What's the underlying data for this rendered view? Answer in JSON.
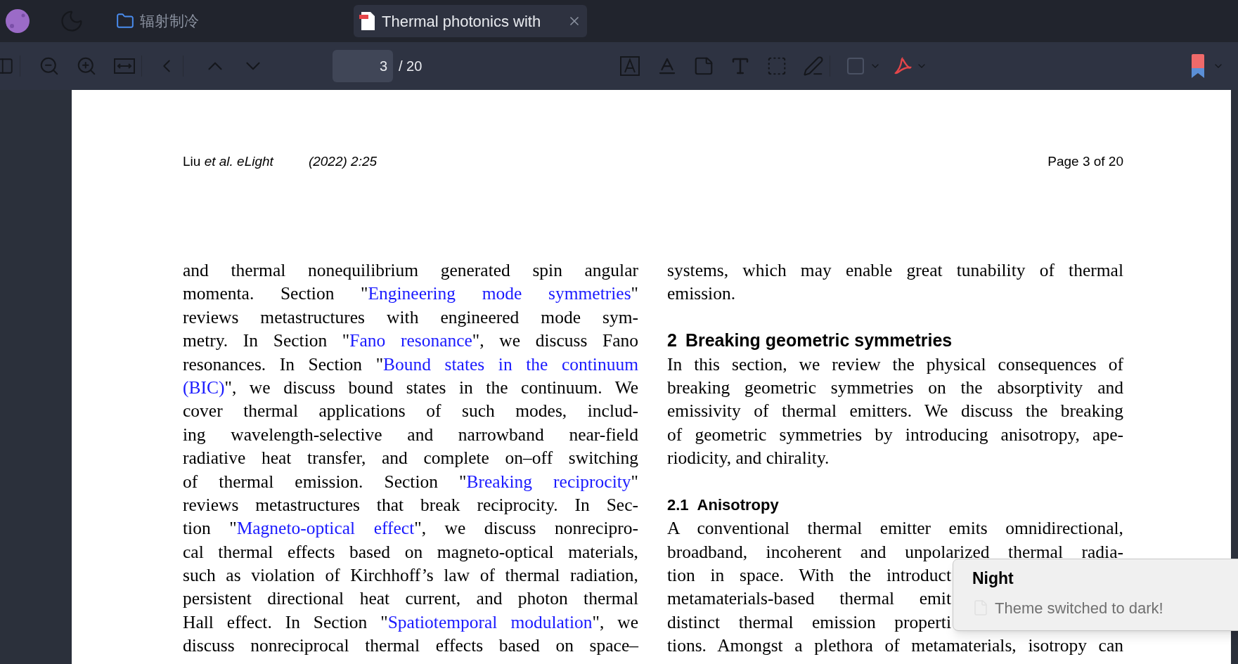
{
  "title_bar": {
    "folder": "辐射制冷",
    "tab": {
      "title": "Thermal photonics with",
      "selected": true
    }
  },
  "toolbar": {
    "page_input": "3",
    "page_total": "/ 20"
  },
  "page": {
    "header": {
      "citation": "Liu *et al. eLight*",
      "volume": "(2022) 2:25",
      "page_label": "Page 3 of 20"
    },
    "left_column": [
      [
        {
          "text": "and thermal nonequilibrium generated spin angular"
        }
      ],
      [
        {
          "text": "momenta. Section \""
        },
        {
          "text": "Engineering mode symmetries",
          "link": true
        },
        {
          "text": "\""
        }
      ],
      [
        {
          "text": "reviews metastructures with engineered mode sym-"
        }
      ],
      [
        {
          "text": "metry. In Section \""
        },
        {
          "text": "Fano resonance",
          "link": true
        },
        {
          "text": "\", we discuss Fano"
        }
      ],
      [
        {
          "text": "resonances. In Section \""
        },
        {
          "text": "Bound states in the continuum",
          "link": true
        }
      ],
      [
        {
          "text": "(BIC)",
          "link": true
        },
        {
          "text": "\", we discuss bound states in the continuum. We"
        }
      ],
      [
        {
          "text": "cover thermal applications of such modes, includ-"
        }
      ],
      [
        {
          "text": "ing wavelength-selective and narrowband near-field"
        }
      ],
      [
        {
          "text": "radiative heat transfer, and complete on–off switching"
        }
      ],
      [
        {
          "text": "of thermal emission. Section \""
        },
        {
          "text": "Breaking reciprocity",
          "link": true
        },
        {
          "text": "\""
        }
      ],
      [
        {
          "text": "reviews metastructures that break reciprocity. In Sec-"
        }
      ],
      [
        {
          "text": "tion \""
        },
        {
          "text": "Magneto-optical effect",
          "link": true
        },
        {
          "text": "\", we discuss nonrecipro-"
        }
      ],
      [
        {
          "text": "cal thermal effects based on magneto-optical materials,"
        }
      ],
      [
        {
          "text": "such as violation of Kirchhoff’s law of thermal radiation,"
        }
      ],
      [
        {
          "text": "persistent directional heat current, and photon thermal"
        }
      ],
      [
        {
          "text": "Hall effect. In Section \""
        },
        {
          "text": "Spatiotemporal modulation",
          "link": true
        },
        {
          "text": "\", we"
        }
      ],
      [
        {
          "text": "discuss nonreciprocal thermal effects based on space–"
        }
      ]
    ],
    "right_column": [
      {
        "kind": "line",
        "text": "systems, which may enable great tunability of thermal"
      },
      {
        "kind": "last",
        "text": "emission."
      },
      {
        "kind": "heading",
        "number": "2",
        "text": "Breaking geometric symmetries"
      },
      {
        "kind": "line",
        "text": "In this section, we review the physical consequences of"
      },
      {
        "kind": "line",
        "text": "breaking geometric symmetries on the absorptivity and"
      },
      {
        "kind": "line",
        "text": "emissivity of thermal emitters. We discuss the breaking"
      },
      {
        "kind": "line",
        "text": "of geometric symmetries by introducing anisotropy, ape-"
      },
      {
        "kind": "last",
        "text": "riodicity, and chirality."
      },
      {
        "kind": "subheading",
        "number": "2.1",
        "text": "Anisotropy"
      },
      {
        "kind": "line",
        "text": "A conventional thermal emitter emits omnidirectional,"
      },
      {
        "kind": "line",
        "text": "broadband, incoherent and unpolarized thermal radia-"
      },
      {
        "kind": "covered",
        "text": "tion in space. With the introduct"
      },
      {
        "kind": "covered",
        "text": "metamaterials-based thermal emit"
      },
      {
        "kind": "covered",
        "text": "distinct thermal emission properti"
      },
      {
        "kind": "line",
        "text": "tions. Amongst a plethora of metamaterials, isotropy can"
      }
    ]
  },
  "toast": {
    "title": "Night",
    "message": "Theme switched to dark!"
  }
}
